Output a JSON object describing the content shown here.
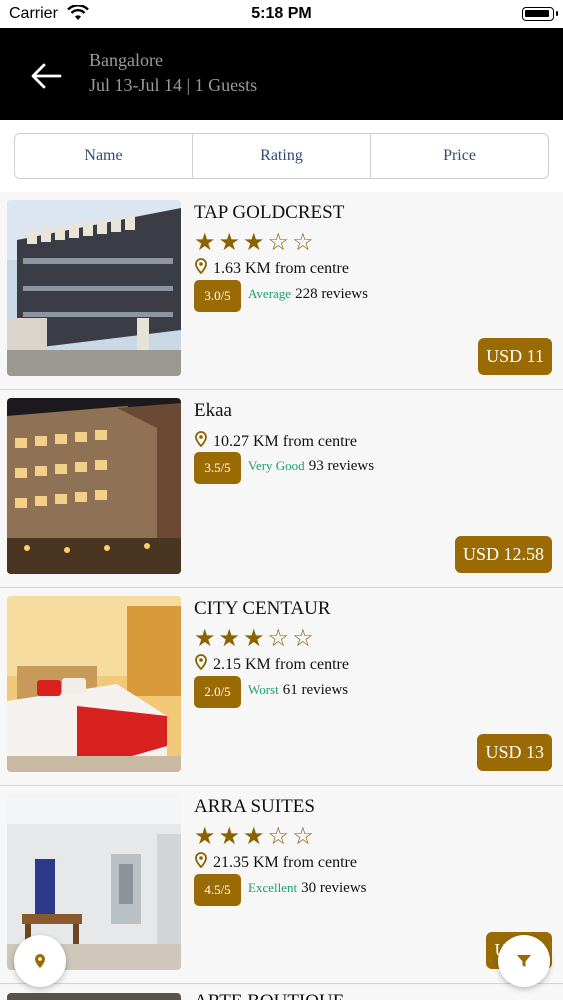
{
  "status_bar": {
    "carrier": "Carrier",
    "time": "5:18 PM"
  },
  "header": {
    "city": "Bangalore",
    "subtitle": "Jul 13-Jul 14 | 1 Guests"
  },
  "sort_tabs": [
    "Name",
    "Rating",
    "Price"
  ],
  "hotels": [
    {
      "name": "TAP GOLDCREST",
      "stars": 3,
      "stars_text": "★★★☆☆",
      "distance": "1.63 KM from centre",
      "rating": "3.0/5",
      "rating_label": "Average",
      "reviews": "228 reviews",
      "price": "USD 11"
    },
    {
      "name": "Ekaa",
      "stars": 0,
      "stars_text": "",
      "distance": "10.27 KM from centre",
      "rating": "3.5/5",
      "rating_label": "Very Good",
      "reviews": "93 reviews",
      "price": "USD 12.58"
    },
    {
      "name": "CITY CENTAUR",
      "stars": 3,
      "stars_text": "★★★☆☆",
      "distance": "2.15 KM from centre",
      "rating": "2.0/5",
      "rating_label": "Worst",
      "reviews": "61 reviews",
      "price": "USD 13"
    },
    {
      "name": "ARRA SUITES",
      "stars": 3,
      "stars_text": "★★★☆☆",
      "distance": "21.35 KM from centre",
      "rating": "4.5/5",
      "rating_label": "Excellent",
      "reviews": "30 reviews",
      "price": "USD 1"
    }
  ],
  "next_hotel": {
    "name": "ARTE BOUTIQUE"
  },
  "colors": {
    "accent": "#9a6b05",
    "rating_label": "#1aa06f",
    "tab_text": "#2f4b70",
    "header_bg": "#000000"
  },
  "icons": {
    "back": "arrow-left-icon",
    "pin": "location-pin-icon",
    "map": "map-pin-icon",
    "filter": "filter-icon"
  }
}
